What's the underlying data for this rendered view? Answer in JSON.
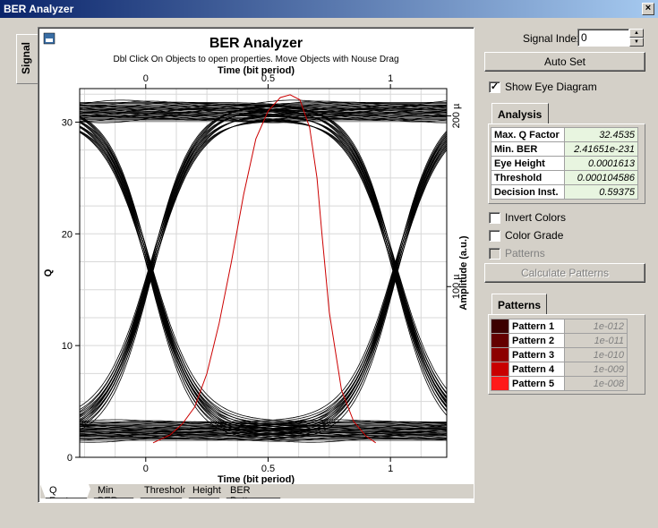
{
  "window": {
    "title": "BER Analyzer",
    "close_label": "×"
  },
  "side_tab": {
    "label": "Signal"
  },
  "chart_tabs": [
    "Q Factor",
    "Min BER",
    "Threshold",
    "Height",
    "BER Pattern"
  ],
  "controls": {
    "signal_index_label": "Signal Index:",
    "signal_index_value": "0",
    "auto_set_label": "Auto Set",
    "show_eye_label": "Show Eye Diagram",
    "show_eye_checked": true,
    "invert_colors_label": "Invert Colors",
    "color_grade_label": "Color Grade",
    "patterns_label": "Patterns",
    "calculate_label": "Calculate Patterns"
  },
  "analysis": {
    "tab_label": "Analysis",
    "rows": [
      {
        "key": "Max. Q Factor",
        "value": "32.4535"
      },
      {
        "key": "Min. BER",
        "value": "2.41651e-231"
      },
      {
        "key": "Eye Height",
        "value": "0.0001613"
      },
      {
        "key": "Threshold",
        "value": "0.000104586"
      },
      {
        "key": "Decision Inst.",
        "value": "0.59375"
      }
    ]
  },
  "patterns": {
    "tab_label": "Patterns",
    "rows": [
      {
        "key": "Pattern 1",
        "value": "1e-012",
        "color": "#3c0000"
      },
      {
        "key": "Pattern 2",
        "value": "1e-011",
        "color": "#640000"
      },
      {
        "key": "Pattern 3",
        "value": "1e-010",
        "color": "#8c0000"
      },
      {
        "key": "Pattern 4",
        "value": "1e-009",
        "color": "#c80000"
      },
      {
        "key": "Pattern 5",
        "value": "1e-008",
        "color": "#ff1a1a"
      }
    ]
  },
  "chart_data": {
    "type": "line",
    "title": "BER Analyzer",
    "subtitle": "Dbl Click On Objects to open properties.  Move Objects with Nouse Drag",
    "xlabel_top": "Time (bit period)",
    "xlabel": "Time (bit period)",
    "ylabel": "Q",
    "ylabel_right": "Amplitude (a.u.)",
    "xlim": [
      -0.27,
      1.23
    ],
    "ylim": [
      0,
      33
    ],
    "x_ticks": [
      0,
      0.5,
      1
    ],
    "x_tick_labels": [
      "0",
      "0.5",
      "1"
    ],
    "y_ticks": [
      0,
      10,
      20,
      30
    ],
    "y_tick_labels": [
      "0",
      "10",
      "20",
      "30"
    ],
    "right_ticks": [
      100,
      200
    ],
    "right_tick_labels": [
      "100 µ",
      "200 µ"
    ],
    "right_lim": [
      0,
      216
    ],
    "grid": true,
    "q_factor_curve": {
      "color": "#cc0000",
      "x": [
        0.03,
        0.1,
        0.15,
        0.2,
        0.25,
        0.3,
        0.35,
        0.4,
        0.45,
        0.5,
        0.55,
        0.59,
        0.63,
        0.67,
        0.7,
        0.72,
        0.75,
        0.8,
        0.85,
        0.9,
        0.94
      ],
      "y": [
        1.3,
        2.0,
        3.0,
        4.5,
        7.5,
        12.0,
        17.5,
        23.5,
        28.5,
        31.0,
        32.2,
        32.45,
        32.0,
        29.5,
        25.0,
        20.0,
        13.0,
        6.0,
        3.2,
        1.9,
        1.3
      ]
    },
    "eye": {
      "color": "#000000",
      "high_level": 31.0,
      "low_level": 2.4,
      "crossing_y": 16.9,
      "crossings_x": [
        0.02,
        1.02
      ]
    }
  }
}
